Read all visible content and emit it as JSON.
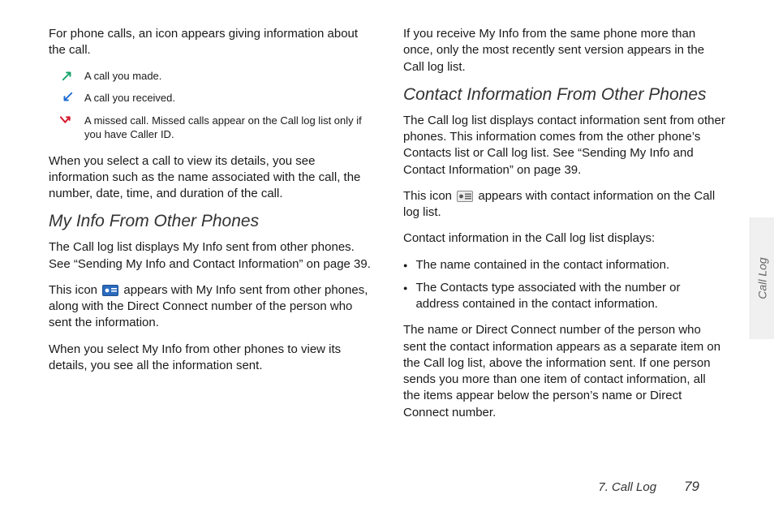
{
  "left": {
    "intro": "For phone calls, an icon appears giving information about the call.",
    "icons": [
      {
        "text": "A call you made."
      },
      {
        "text": "A call you received."
      },
      {
        "text": "A missed call. Missed calls appear on the Call log list only if you have Caller ID."
      }
    ],
    "select_detail": "When you select a call to view its details, you see information such as the name associated with the call, the number, date, time, and duration of the call.",
    "heading1": "My Info From Other Phones",
    "my_info_p1": "The Call log list displays My Info sent from other phones. See “Sending My Info and Contact Information” on page 39.",
    "my_info_icon_pre": "This icon ",
    "my_info_icon_post": " appears with My Info sent from other phones, along with the Direct Connect number of the person who sent the information.",
    "my_info_p3": "When you select My Info from other phones to view its details, you see all the information sent."
  },
  "right": {
    "top": "If you receive My Info from the same phone more than once, only the most recently sent version appears in the Call log list.",
    "heading2": "Contact Information From Other Phones",
    "ci_p1": "The Call log list displays contact information sent from other phones. This information comes from the other phone’s Contacts list or Call log list. See “Sending My Info and Contact Information” on page 39.",
    "ci_icon_pre": "This icon ",
    "ci_icon_post": " appears with contact information on the Call log list.",
    "ci_p3": "Contact information in the Call log list displays:",
    "bullets": [
      "The name contained in the contact information.",
      "The Contacts type associated with the number or address contained in the contact information."
    ],
    "ci_p4": "The name or Direct Connect number of the person who sent the contact information appears as a separate item on the Call log list, above the information sent. If one person sends you more than one item of contact information, all the items appear below the person’s name or Direct Connect number."
  },
  "side_tab": "Call Log",
  "footer": {
    "chapter": "7. Call Log",
    "page": "79"
  }
}
